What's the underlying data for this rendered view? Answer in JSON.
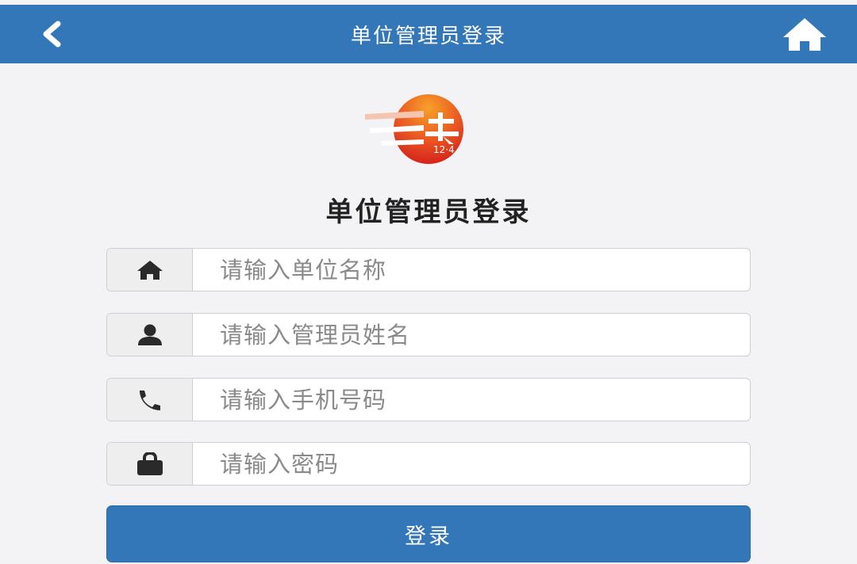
{
  "header": {
    "title": "单位管理员登录",
    "back_icon": "chevron-left-icon",
    "home_icon": "home-icon"
  },
  "logo": {
    "text": "12·4"
  },
  "heading": "单位管理员登录",
  "form": {
    "unit_name": {
      "placeholder": "请输入单位名称",
      "icon": "home-icon"
    },
    "admin_name": {
      "placeholder": "请输入管理员姓名",
      "icon": "user-icon"
    },
    "phone": {
      "placeholder": "请输入手机号码",
      "icon": "phone-icon"
    },
    "password": {
      "placeholder": "请输入密码",
      "icon": "lock-icon"
    }
  },
  "login_button": "登录",
  "colors": {
    "primary": "#3377b9",
    "background": "#f3f2f4",
    "logo_red": "#e0321e"
  }
}
